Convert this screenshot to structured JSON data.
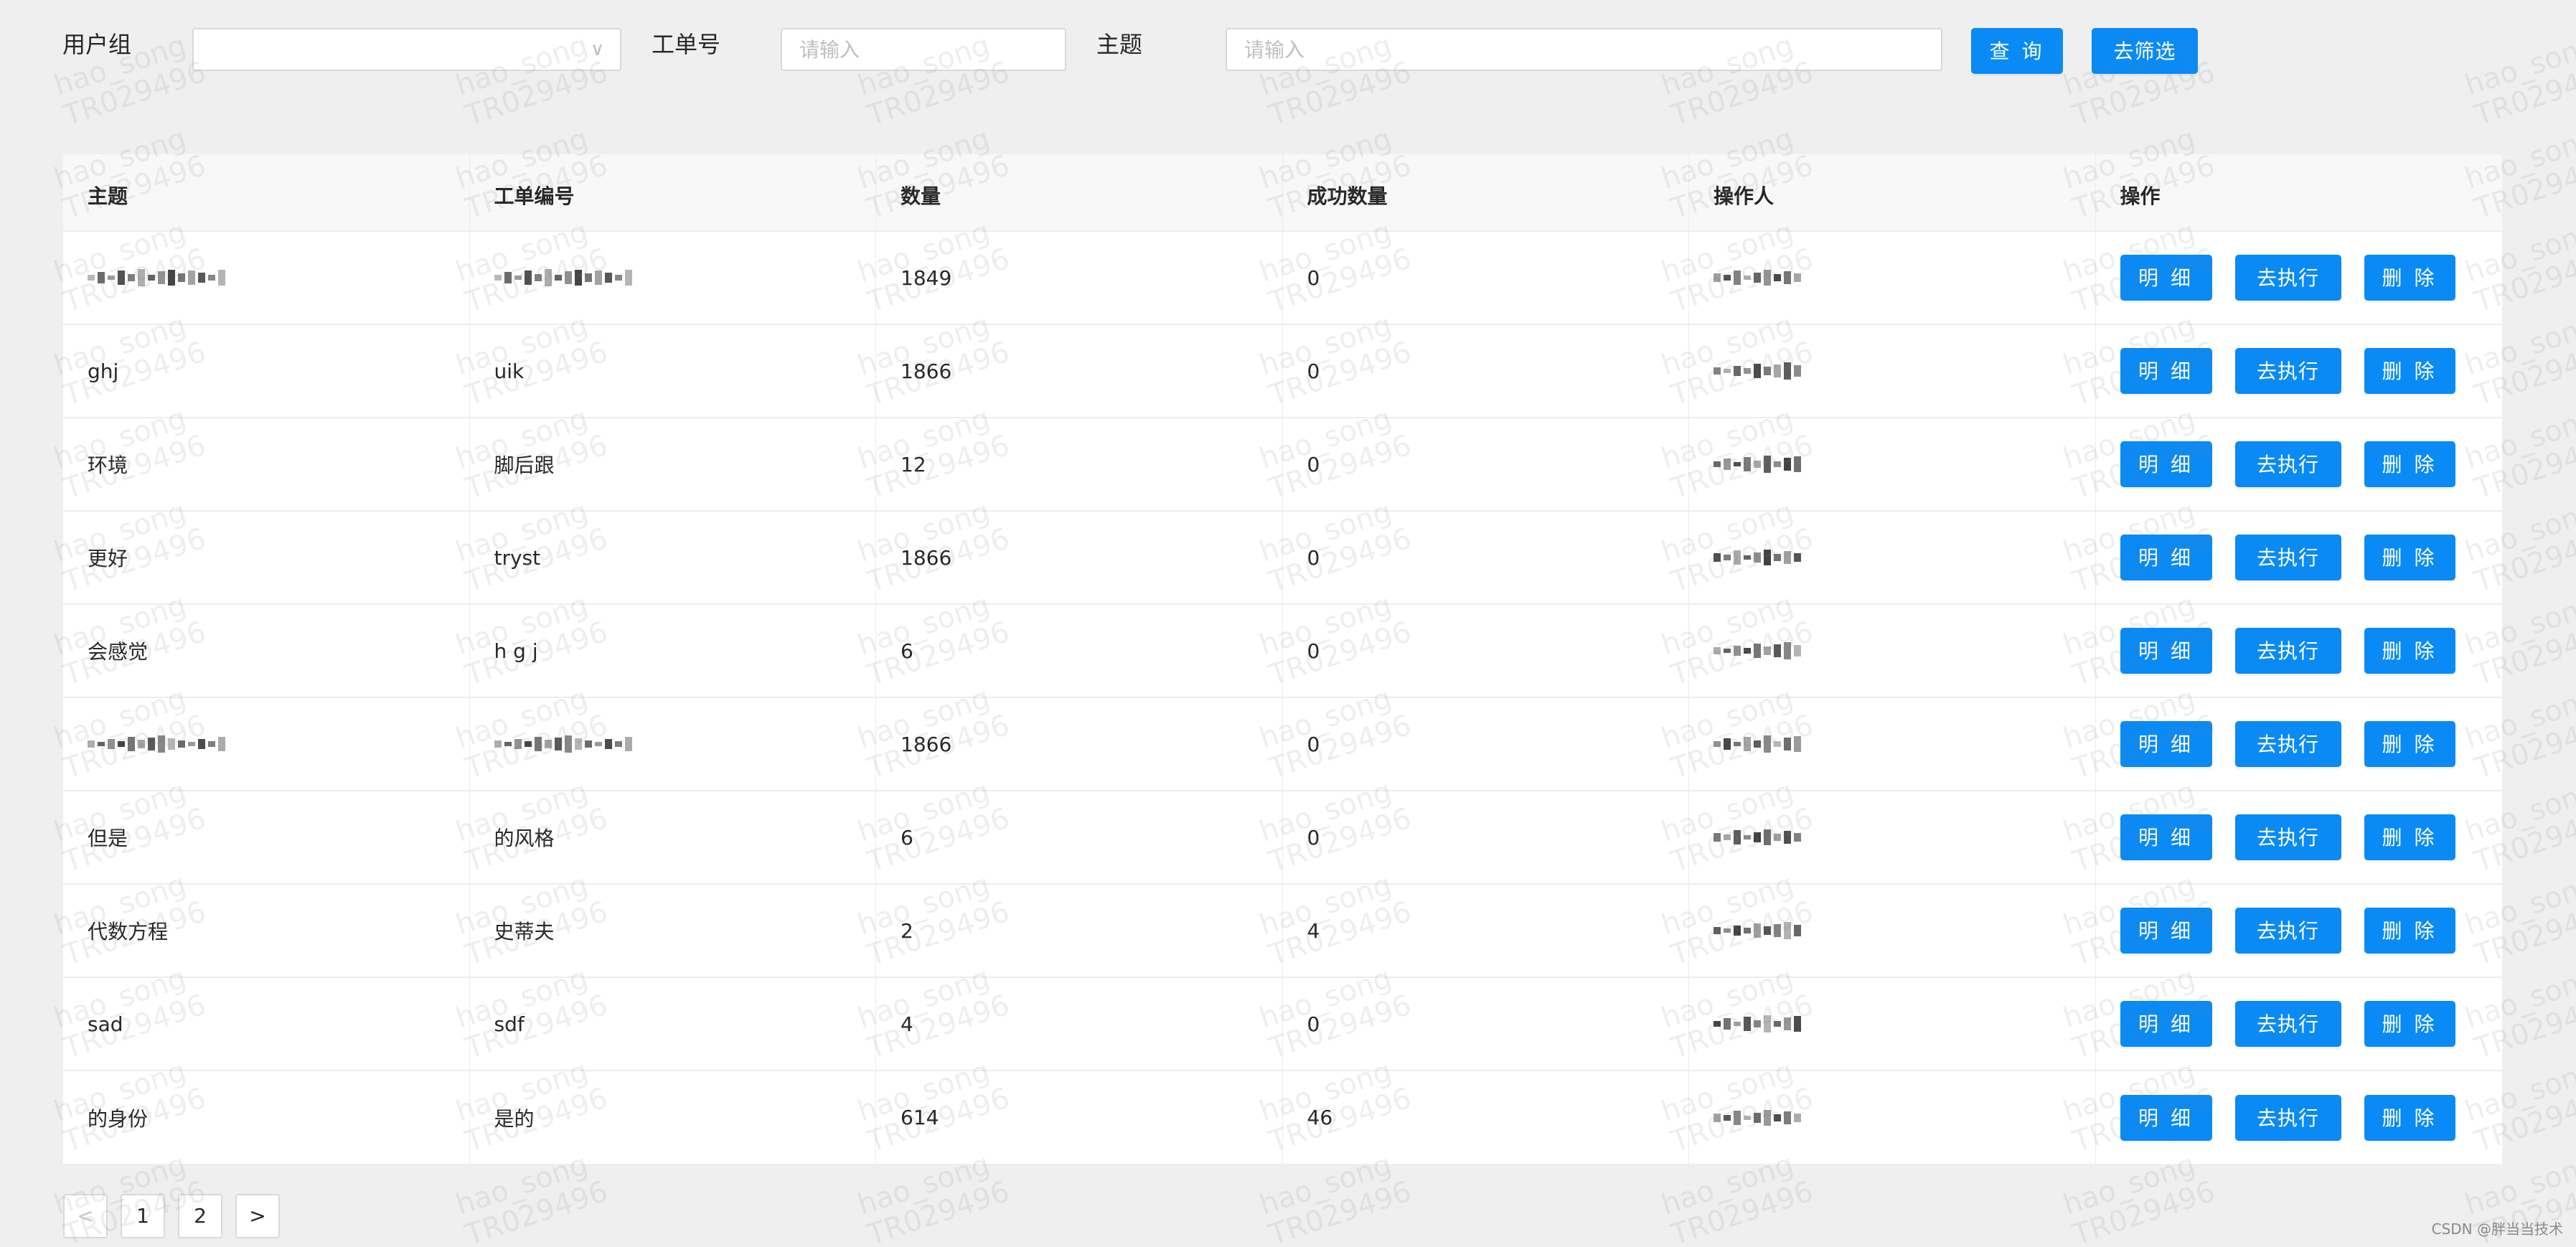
{
  "filter": {
    "user_group_label": "用户组",
    "user_group_value": "",
    "order_no_label": "工单号",
    "order_no_placeholder": "请输入",
    "subject_label": "主题",
    "subject_placeholder": "请输入",
    "query_button": "查 询",
    "filter_button": "去筛选"
  },
  "table": {
    "columns": [
      "主题",
      "工单编号",
      "数量",
      "成功数量",
      "操作人",
      "操作"
    ],
    "row_actions": {
      "detail": "明 细",
      "execute": "去执行",
      "delete": "删 除"
    },
    "rows": [
      {
        "subject": "[redacted]",
        "subject_redacted": true,
        "order_no": "[redacted]",
        "order_no_redacted": true,
        "quantity": "1849",
        "success": "0",
        "operator": "[redacted]"
      },
      {
        "subject": "ghj",
        "order_no": "uik",
        "quantity": "1866",
        "success": "0",
        "operator": "[redacted]"
      },
      {
        "subject": "环境",
        "order_no": "脚后跟",
        "quantity": "12",
        "success": "0",
        "operator": "[redacted]"
      },
      {
        "subject": "更好",
        "order_no": "tryst",
        "quantity": "1866",
        "success": "0",
        "operator": "[redacted]"
      },
      {
        "subject": "会感觉",
        "order_no": "h g j",
        "quantity": "6",
        "success": "0",
        "operator": "[redacted]"
      },
      {
        "subject": "[redacted]",
        "subject_redacted": true,
        "order_no": "[redacted]",
        "order_no_redacted": true,
        "quantity": "1866",
        "success": "0",
        "operator": "[redacted]"
      },
      {
        "subject": "但是",
        "order_no": "的风格",
        "quantity": "6",
        "success": "0",
        "operator": "[redacted]"
      },
      {
        "subject": "代数方程",
        "order_no": "史蒂夫",
        "quantity": "2",
        "success": "4",
        "operator": "[redacted]"
      },
      {
        "subject": "sad",
        "order_no": "sdf",
        "quantity": "4",
        "success": "0",
        "operator": "[redacted]"
      },
      {
        "subject": "的身份",
        "order_no": "是的",
        "quantity": "614",
        "success": "46",
        "operator": "[redacted]"
      }
    ]
  },
  "pagination": {
    "prev_icon": "chevron-left-icon",
    "pages": [
      "1",
      "2"
    ],
    "next_icon": "chevron-right-icon",
    "prev_glyph": "<",
    "next_glyph": ">"
  },
  "watermark": {
    "line1": "hao_song",
    "line2": "TR029496"
  },
  "credit": "CSDN @胖当当技术",
  "colors": {
    "primary": "#0a8af5",
    "page_bg": "#efefef",
    "header_bg": "#f8f8f8"
  }
}
